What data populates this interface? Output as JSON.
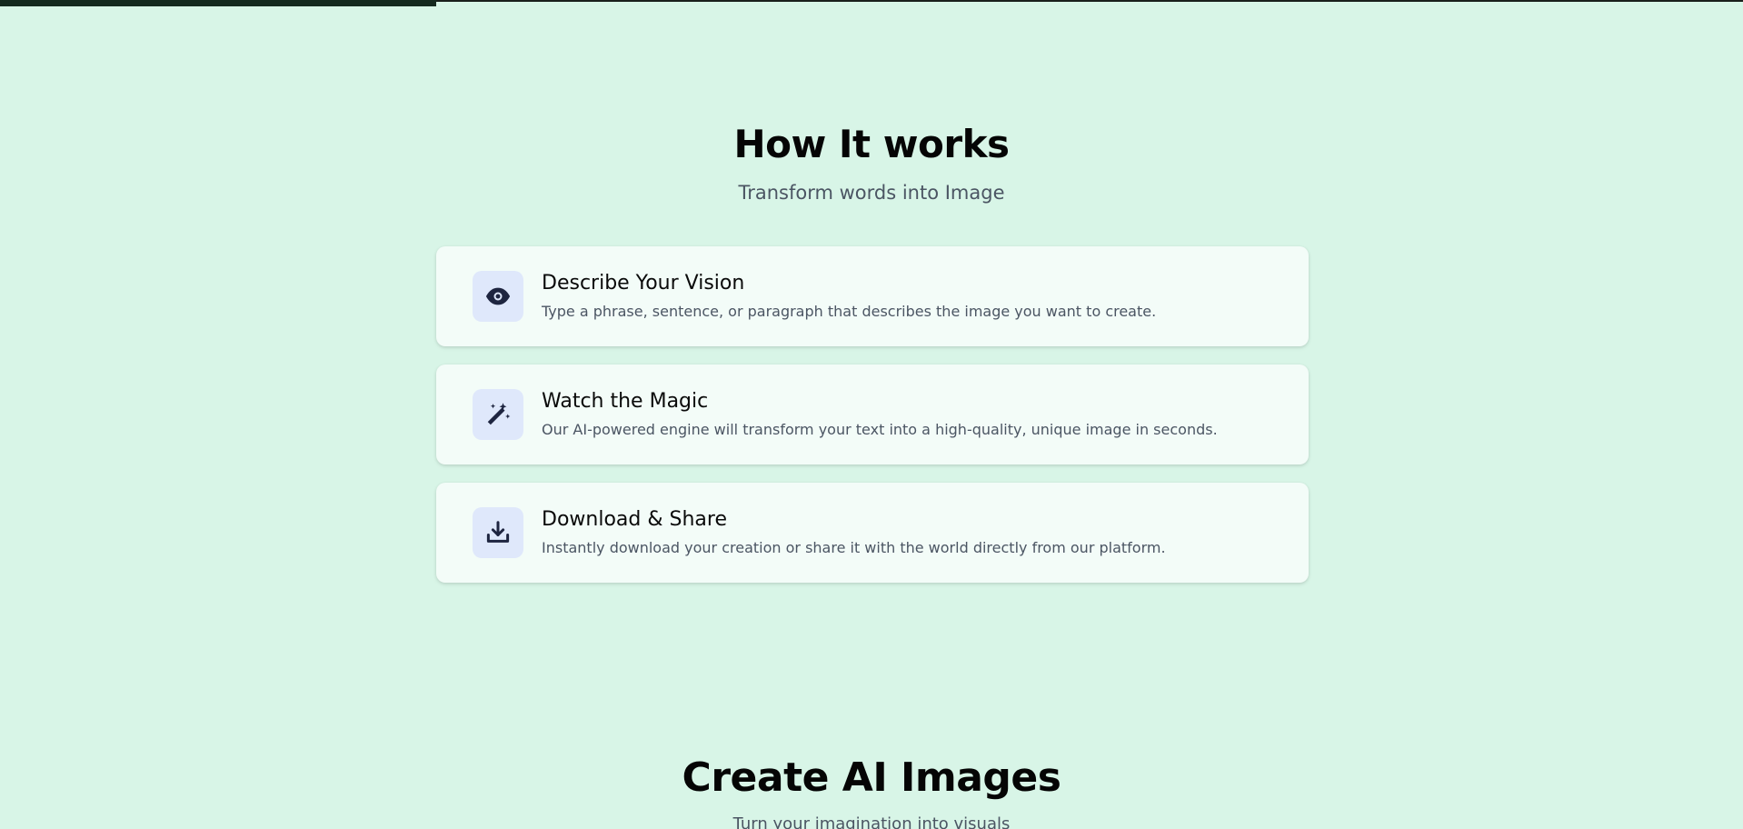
{
  "progress": {
    "fraction": 0.25
  },
  "how_it_works": {
    "title": "How It works",
    "subtitle": "Transform words into Image",
    "steps": [
      {
        "icon": "eye-icon",
        "title": "Describe Your Vision",
        "description": "Type a phrase, sentence, or paragraph that describes the image you want to create."
      },
      {
        "icon": "magic-wand-icon",
        "title": "Watch the Magic",
        "description": "Our AI-powered engine will transform your text into a high-quality, unique image in seconds."
      },
      {
        "icon": "download-icon",
        "title": "Download & Share",
        "description": "Instantly download your creation or share it with the world directly from our platform."
      }
    ]
  },
  "create_section": {
    "title": "Create AI Images",
    "subtitle": "Turn your imagination into visuals"
  },
  "colors": {
    "background": "#d8f5e7",
    "card": "#f3fcf8",
    "icon_bg": "#dfe8fb",
    "icon_fg": "#1e2540",
    "progress": "#152a1f"
  }
}
